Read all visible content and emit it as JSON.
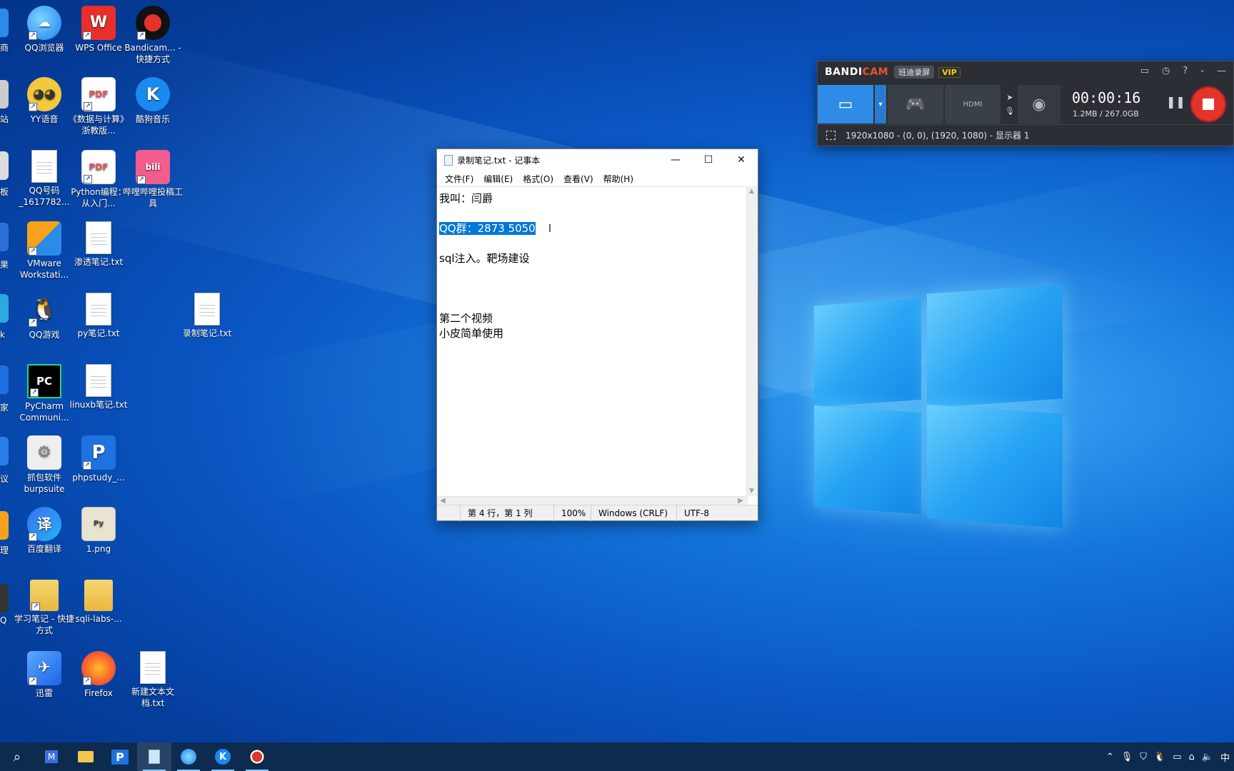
{
  "desktop": {
    "icons": [
      {
        "label": "QQ浏览器"
      },
      {
        "label": "WPS Office"
      },
      {
        "label": "Bandicam... - 快捷方式"
      },
      {
        "label": "YY语音"
      },
      {
        "label": "《数据与计算》浙教版..."
      },
      {
        "label": "酷狗音乐"
      },
      {
        "label": "QQ号码_1617782..."
      },
      {
        "label": "Python编程：从入门..."
      },
      {
        "label": "哔哩哔哩投稿工具"
      },
      {
        "label": "VMware Workstati..."
      },
      {
        "label": "渗透笔记.txt"
      },
      {
        "label": "QQ游戏"
      },
      {
        "label": "py笔记.txt"
      },
      {
        "label": "录制笔记.txt"
      },
      {
        "label": "PyCharm Communi..."
      },
      {
        "label": "linuxb笔记.txt"
      },
      {
        "label": "抓包软件burpsuite"
      },
      {
        "label": "phpstudy_..."
      },
      {
        "label": "百度翻译"
      },
      {
        "label": "1.png"
      },
      {
        "label": "学习笔记 - 快捷方式"
      },
      {
        "label": "sqli-labs-..."
      },
      {
        "label": "迅雷"
      },
      {
        "label": "Firefox"
      },
      {
        "label": "新建文本文档.txt"
      }
    ],
    "left_partial_labels": [
      "商",
      "站",
      "板",
      "果",
      "k",
      "家",
      "议",
      "理",
      "Q"
    ]
  },
  "notepad": {
    "title": "录制笔记.txt - 记事本",
    "menu": [
      "文件(F)",
      "编辑(E)",
      "格式(O)",
      "查看(V)",
      "帮助(H)"
    ],
    "lines": [
      "我叫：闫爵",
      "",
      "QQ群：2873 5050",
      "",
      "sql注入。靶场建设",
      "",
      "",
      "",
      "第二个视频",
      "小皮简单使用"
    ],
    "status": {
      "position": "第 4 行，第 1 列",
      "zoom": "100%",
      "line_ending": "Windows (CRLF)",
      "encoding": "UTF-8"
    }
  },
  "bandicam": {
    "logo_a": "BANDI",
    "logo_b": "CAM",
    "cn_name": "班迪录屏",
    "vip": "VIP",
    "timer": "00:00:16",
    "size": "1.2MB / 267.0GB",
    "region": "1920x1080 - (0, 0), (1920, 1080) - 显示器 1",
    "hdmi_label": "HDMI"
  }
}
